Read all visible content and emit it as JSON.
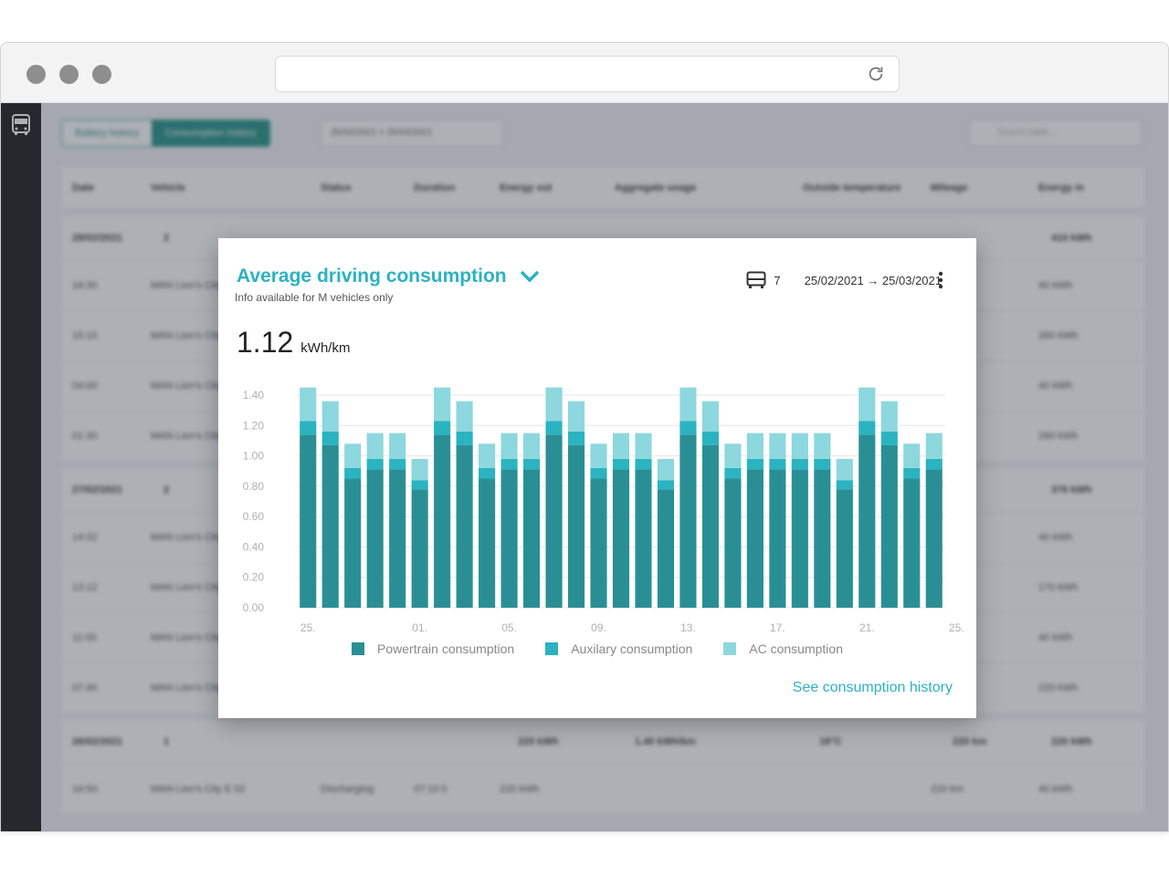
{
  "browser": {
    "url": ""
  },
  "background": {
    "tabs": [
      "Battery history",
      "Consumption history"
    ],
    "date_filter": "25/02/2021 > 25/03/2021",
    "search_placeholder": "Search table...",
    "columns": [
      "Date",
      "Vehicle",
      "Status",
      "Duration",
      "Energy out",
      "Aggregate usage",
      "Outside temperature",
      "Mileage",
      "Energy in"
    ],
    "groups": [
      {
        "date": "28/02/2021",
        "count": "2",
        "energy": "410 kWh",
        "rows": [
          {
            "time": "16:30",
            "vehicle": "MAN Lion's City",
            "energy_in": "40 kWh"
          },
          {
            "time": "15:10",
            "vehicle": "MAN Lion's City",
            "energy_in": "260 kWh"
          },
          {
            "time": "04:00",
            "vehicle": "MAN Lion's City",
            "energy_in": "40 kWh"
          },
          {
            "time": "01:30",
            "vehicle": "MAN Lion's City",
            "energy_in": "260 kWh"
          }
        ]
      },
      {
        "date": "27/02/2021",
        "count": "2",
        "energy": "370 kWh",
        "rows": [
          {
            "time": "14:32",
            "vehicle": "MAN Lion's City",
            "energy_in": "40 kWh"
          },
          {
            "time": "13:12",
            "vehicle": "MAN Lion's City",
            "energy_in": "170 kWh"
          },
          {
            "time": "11:00",
            "vehicle": "MAN Lion's City",
            "energy_in": "40 kWh"
          },
          {
            "time": "07:40",
            "vehicle": "MAN Lion's City",
            "energy_in": "220 kWh"
          }
        ]
      },
      {
        "date": "26/02/2021",
        "count": "1",
        "energy": "220 kWh",
        "energy_out": "220 kWh",
        "usage": "1.40 kWh/km",
        "temp": "18°C",
        "mileage": "220 km",
        "rows": [
          {
            "time": "16:50",
            "vehicle": "MAN Lion's City E 02",
            "status": "Discharging",
            "duration": "07:10 h",
            "energy_out": "220 kWh",
            "mileage": "220 km",
            "energy_in": "40 kWh"
          }
        ]
      }
    ]
  },
  "widget": {
    "title": "Average driving consumption",
    "subtitle": "Info available for M vehicles only",
    "vehicle_count": "7",
    "date_range": "25/02/2021 → 25/03/2021",
    "metric_value": "1.12",
    "metric_unit": "kWh/km",
    "link": "See consumption history"
  },
  "colors": {
    "accent": "#2cb2c2",
    "powertrain": "#2a8f95",
    "auxiliary": "#2bb3c0",
    "ac": "#8dd7de"
  },
  "chart_data": {
    "type": "bar",
    "stacked": true,
    "ylim": [
      0,
      1.4
    ],
    "yticks": [
      "0.00",
      "0.20",
      "0.40",
      "0.60",
      "0.80",
      "1.00",
      "1.20",
      "1.40"
    ],
    "xtick_labels": [
      {
        "index": 0,
        "label": "25."
      },
      {
        "index": 5,
        "label": "01."
      },
      {
        "index": 9,
        "label": "05."
      },
      {
        "index": 13,
        "label": "09."
      },
      {
        "index": 17,
        "label": "13."
      },
      {
        "index": 21,
        "label": "17."
      },
      {
        "index": 25,
        "label": "21."
      },
      {
        "index": 29,
        "label": "25."
      }
    ],
    "grid": true,
    "legend": "bottom",
    "series": [
      {
        "name": "Powertrain consumption",
        "values": [
          1.14,
          1.07,
          0.85,
          0.91,
          0.91,
          0.78,
          1.14,
          1.07,
          0.85,
          0.91,
          0.91,
          1.14,
          1.07,
          0.85,
          0.91,
          0.91,
          0.78,
          1.14,
          1.07,
          0.85,
          0.91,
          0.91,
          0.91,
          0.91,
          0.78,
          1.14,
          1.07,
          0.85,
          0.91
        ]
      },
      {
        "name": "Auxilary consumption",
        "values": [
          0.09,
          0.09,
          0.07,
          0.07,
          0.07,
          0.06,
          0.09,
          0.09,
          0.07,
          0.07,
          0.07,
          0.09,
          0.09,
          0.07,
          0.07,
          0.07,
          0.06,
          0.09,
          0.09,
          0.07,
          0.07,
          0.07,
          0.07,
          0.07,
          0.06,
          0.09,
          0.09,
          0.07,
          0.07
        ]
      },
      {
        "name": "AC consumption",
        "values": [
          0.22,
          0.2,
          0.16,
          0.17,
          0.17,
          0.14,
          0.22,
          0.2,
          0.16,
          0.17,
          0.17,
          0.22,
          0.2,
          0.16,
          0.17,
          0.17,
          0.14,
          0.22,
          0.2,
          0.16,
          0.17,
          0.17,
          0.17,
          0.17,
          0.14,
          0.22,
          0.2,
          0.16,
          0.17
        ]
      }
    ]
  }
}
